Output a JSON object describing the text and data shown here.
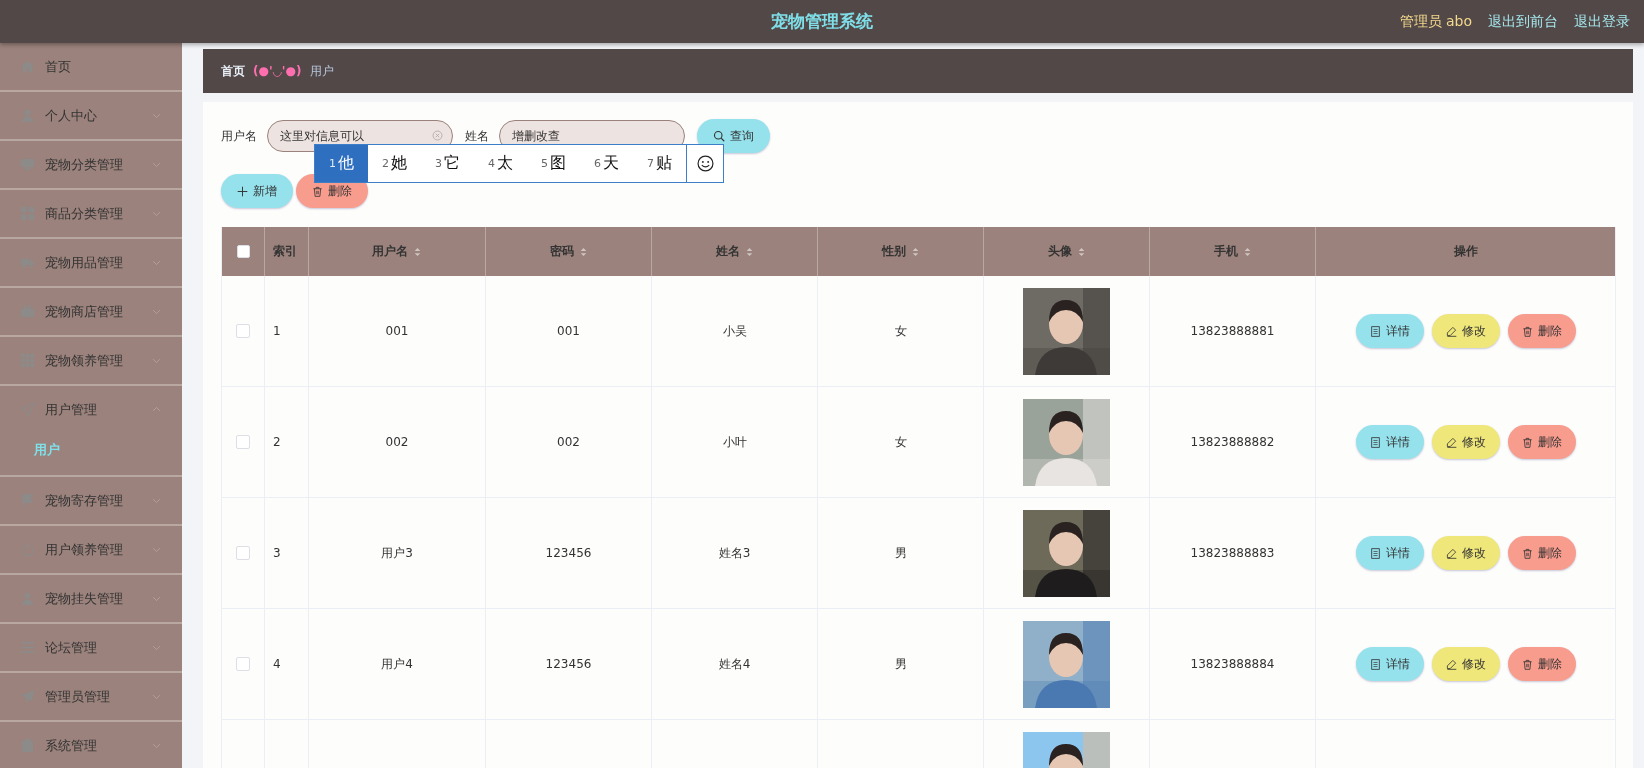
{
  "header": {
    "title": "宠物管理系统",
    "user": "管理员 abo",
    "links": [
      "退出到前台",
      "退出登录"
    ]
  },
  "sidebar": {
    "items": [
      {
        "label": "首页"
      },
      {
        "label": "个人中心",
        "expanded": false
      },
      {
        "label": "宠物分类管理",
        "expanded": false
      },
      {
        "label": "商品分类管理",
        "expanded": false
      },
      {
        "label": "宠物用品管理",
        "expanded": false
      },
      {
        "label": "宠物商店管理",
        "expanded": false
      },
      {
        "label": "宠物领养管理",
        "expanded": false
      },
      {
        "label": "用户管理",
        "expanded": true,
        "children": [
          {
            "label": "用户",
            "selected": true
          }
        ]
      },
      {
        "label": "宠物寄存管理",
        "expanded": false
      },
      {
        "label": "用户领养管理",
        "expanded": false
      },
      {
        "label": "宠物挂失管理",
        "expanded": false
      },
      {
        "label": "论坛管理",
        "expanded": false
      },
      {
        "label": "管理员管理",
        "expanded": false
      },
      {
        "label": "系统管理",
        "expanded": false
      }
    ]
  },
  "breadcrumb": {
    "home": "首页",
    "separator": "(●'◡'●)",
    "current": "用户"
  },
  "search": {
    "fields": [
      {
        "label": "用户名",
        "value": "这里对信息可以",
        "clearable": true
      },
      {
        "label": "姓名",
        "value": "增删改查",
        "clearable": false
      }
    ],
    "button": "查询"
  },
  "ime_candidates": [
    {
      "index": "1",
      "char": "他",
      "selected": true
    },
    {
      "index": "2",
      "char": "她",
      "selected": false
    },
    {
      "index": "3",
      "char": "它",
      "selected": false
    },
    {
      "index": "4",
      "char": "太",
      "selected": false
    },
    {
      "index": "5",
      "char": "图",
      "selected": false
    },
    {
      "index": "6",
      "char": "天",
      "selected": false
    },
    {
      "index": "7",
      "char": "贴",
      "selected": false
    }
  ],
  "actions": [
    {
      "kind": "add",
      "label": "新增"
    },
    {
      "kind": "delete",
      "label": "删除"
    }
  ],
  "table": {
    "select_all_checked": false,
    "columns": [
      {
        "label": "索引",
        "sortable": false
      },
      {
        "label": "用户名",
        "sortable": true
      },
      {
        "label": "密码",
        "sortable": true
      },
      {
        "label": "姓名",
        "sortable": true
      },
      {
        "label": "性别",
        "sortable": true
      },
      {
        "label": "头像",
        "sortable": true
      },
      {
        "label": "手机",
        "sortable": true
      },
      {
        "label": "操作",
        "sortable": false
      }
    ],
    "rows": [
      {
        "checked": false,
        "cells": [
          "1",
          "001",
          "001",
          "小吴",
          "女"
        ],
        "avatar": {
          "kind": "picture"
        },
        "phone": "13823888881",
        "buttons": [
          {
            "kind": "detail",
            "label": "详情"
          },
          {
            "kind": "edit",
            "label": "修改"
          },
          {
            "kind": "delete",
            "label": "删除"
          }
        ]
      },
      {
        "checked": false,
        "cells": [
          "2",
          "002",
          "002",
          "小叶",
          "女"
        ],
        "avatar": {
          "kind": "picture"
        },
        "phone": "13823888882",
        "buttons": [
          {
            "kind": "detail",
            "label": "详情"
          },
          {
            "kind": "edit",
            "label": "修改"
          },
          {
            "kind": "delete",
            "label": "删除"
          }
        ]
      },
      {
        "checked": false,
        "cells": [
          "3",
          "用户3",
          "123456",
          "姓名3",
          "男"
        ],
        "avatar": {
          "kind": "picture"
        },
        "phone": "13823888883",
        "buttons": [
          {
            "kind": "detail",
            "label": "详情"
          },
          {
            "kind": "edit",
            "label": "修改"
          },
          {
            "kind": "delete",
            "label": "删除"
          }
        ]
      },
      {
        "checked": false,
        "cells": [
          "4",
          "用户4",
          "123456",
          "姓名4",
          "男"
        ],
        "avatar": {
          "kind": "picture"
        },
        "phone": "13823888884",
        "buttons": [
          {
            "kind": "detail",
            "label": "详情"
          },
          {
            "kind": "edit",
            "label": "修改"
          },
          {
            "kind": "delete",
            "label": "删除"
          }
        ]
      },
      {
        "avatar": {
          "kind": "picture"
        }
      }
    ]
  }
}
